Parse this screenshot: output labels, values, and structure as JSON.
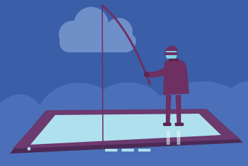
{
  "scene": {
    "colors": {
      "sky": "#3a5ea8",
      "hills": "#4b70b9",
      "cloud": "#6f8fc9",
      "tablet_frame": "#6b3a6e",
      "tablet_screen": "#aee0ee",
      "fisherman_coat": "#6e2f62",
      "fisherman_face": "#7fd1e0",
      "rod": "#6e2f62",
      "fishing_line": "#6e2f62"
    },
    "elements": {
      "cloud": "cloud",
      "tablet": "tablet",
      "fisherman": "fisherman",
      "fishing_rod": "fishing-rod",
      "fishing_line": "fishing-line"
    }
  }
}
